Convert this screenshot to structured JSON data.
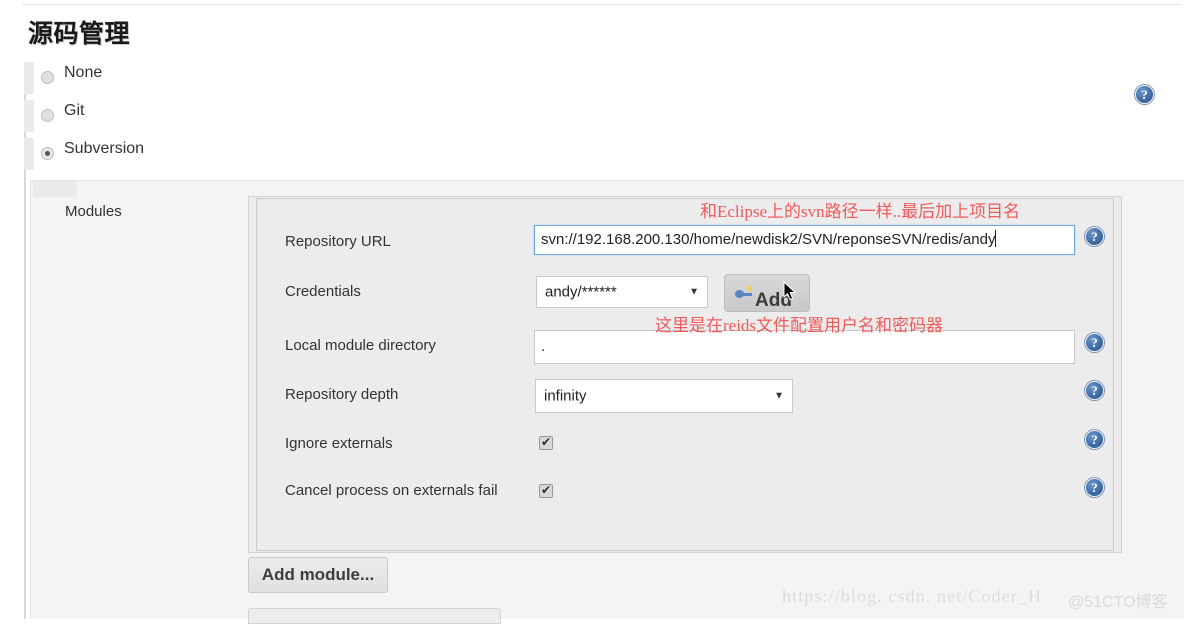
{
  "page": {
    "title": "源码管理"
  },
  "scm": {
    "options": [
      {
        "label": "None",
        "selected": false
      },
      {
        "label": "Git",
        "selected": false
      },
      {
        "label": "Subversion",
        "selected": true
      }
    ],
    "help_icon": "help-icon"
  },
  "sidebar": {
    "modules_label": "Modules"
  },
  "module": {
    "fields": {
      "repository_url": {
        "label": "Repository URL",
        "value": "svn://192.168.200.130/home/newdisk2/SVN/reponseSVN/redis/andy",
        "placeholder": ""
      },
      "credentials": {
        "label": "Credentials",
        "value": "andy/******",
        "add_button": "Add"
      },
      "local_module_directory": {
        "label": "Local module directory",
        "value": ".",
        "placeholder": ""
      },
      "repository_depth": {
        "label": "Repository depth",
        "value": "infinity"
      },
      "ignore_externals": {
        "label": "Ignore externals",
        "checked": true
      },
      "cancel_process_on_externals_fail": {
        "label": "Cancel process on externals fail",
        "checked": true
      }
    },
    "add_module_button": "Add module..."
  },
  "annotations": {
    "url_note": "和Eclipse上的svn路径一样..最后加上项目名",
    "credentials_note": "这里是在reids文件配置用户名和密码器"
  },
  "watermarks": {
    "blog_url": "https://blog. csdn. net/Coder_H",
    "site": "@51CTO博客"
  },
  "colors": {
    "accent_focus": "#6aa7e8",
    "annotation_red": "#f05b5b",
    "help_blue": "#3f6da8",
    "panel_bg": "#ececec",
    "band_bg": "#f4f4f4"
  }
}
